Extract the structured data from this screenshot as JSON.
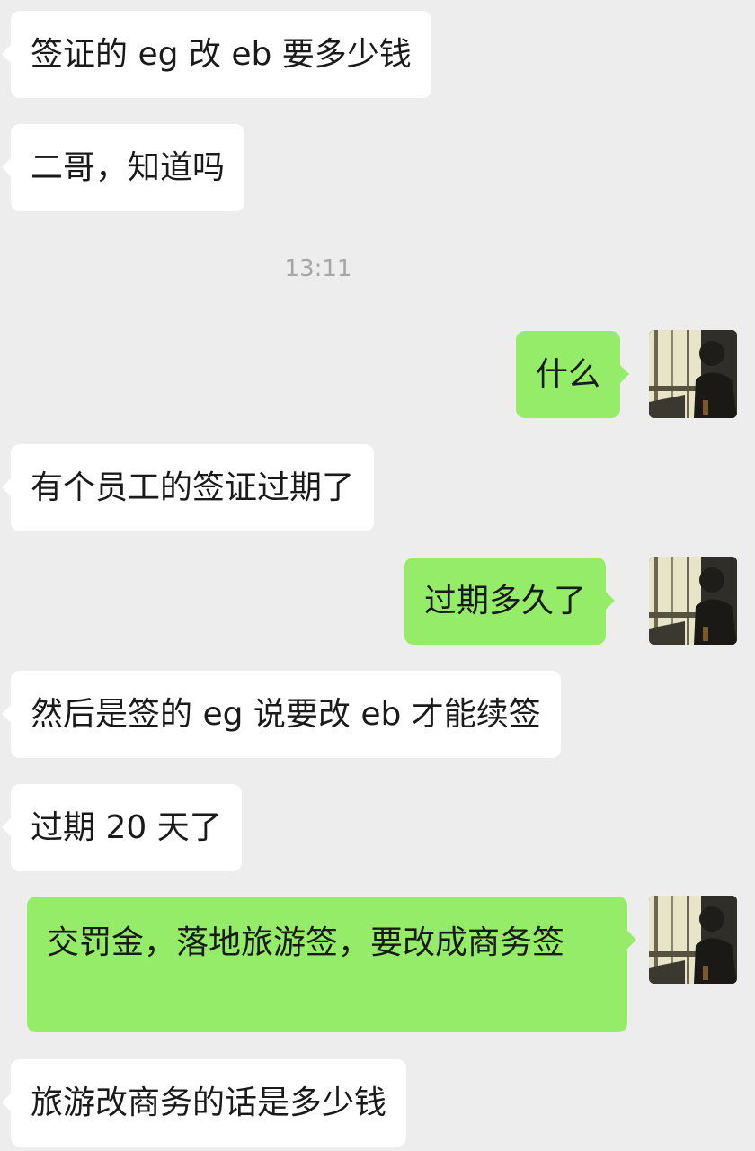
{
  "timestamp": "13:11",
  "messages": [
    {
      "side": "in",
      "text": "签证的 eg 改 eb 要多少钱"
    },
    {
      "side": "in",
      "text": "二哥，知道吗"
    },
    {
      "side": "out",
      "text": "什么"
    },
    {
      "side": "in",
      "text": "有个员工的签证过期了"
    },
    {
      "side": "out",
      "text": "过期多久了"
    },
    {
      "side": "in",
      "text": "然后是签的 eg 说要改 eb 才能续签"
    },
    {
      "side": "in",
      "text": "过期 20 天了"
    },
    {
      "side": "out",
      "text": "交罚金，落地旅游签，要改成商务签"
    },
    {
      "side": "in",
      "text": "旅游改商务的话是多少钱"
    }
  ],
  "colors": {
    "background": "#ededed",
    "incoming_bubble": "#ffffff",
    "outgoing_bubble": "#95ec69",
    "timestamp_text": "#a6a6a6"
  },
  "icons": {
    "avatar": "user-avatar-photo"
  }
}
